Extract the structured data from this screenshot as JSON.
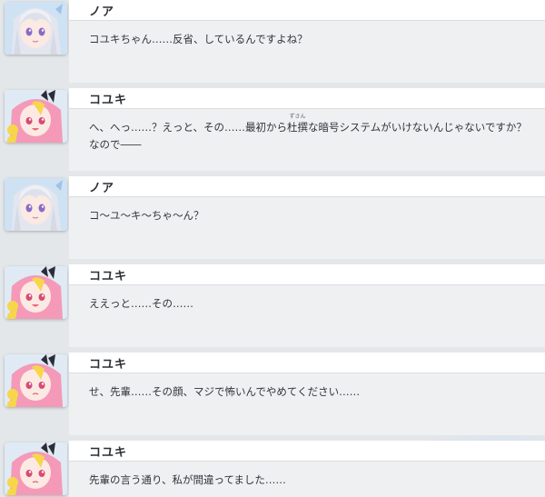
{
  "messages": [
    {
      "speaker": "ノア",
      "avatar": "noa-portrait",
      "lines": [
        "コユキちゃん……反省、しているんですよね？"
      ]
    },
    {
      "speaker": "コユキ",
      "avatar": "koyuki-portrait",
      "line1": {
        "before": "へ、へっ……？えっと、その……最初から",
        "ruby_base": "杜撰",
        "ruby": "ずさん",
        "after": "な暗号システムがいけないんじゃないですか？"
      },
      "lines": [
        "なので――"
      ]
    },
    {
      "speaker": "ノア",
      "avatar": "noa-portrait",
      "lines": [
        "コ～ユ～キ～ちゃ～ん？"
      ]
    },
    {
      "speaker": "コユキ",
      "avatar": "koyuki-portrait",
      "lines": [
        "ええっと……その……"
      ]
    },
    {
      "speaker": "コユキ",
      "avatar": "koyuki-portrait",
      "lines": [
        "せ、先輩……その顔、マジで怖いんでやめてください……"
      ]
    },
    {
      "speaker": "コユキ",
      "avatar": "koyuki-portrait",
      "lines": [
        "先輩の言う通り、私が間違ってました……"
      ]
    }
  ],
  "colors": {
    "noa_hair": "#e3e6ee",
    "noa_eyes": "#8a6bc4",
    "koyuki_hair": "#f49ab8",
    "koyuki_yellow": "#f7d64a",
    "koyuki_eyes": "#d64b74"
  }
}
